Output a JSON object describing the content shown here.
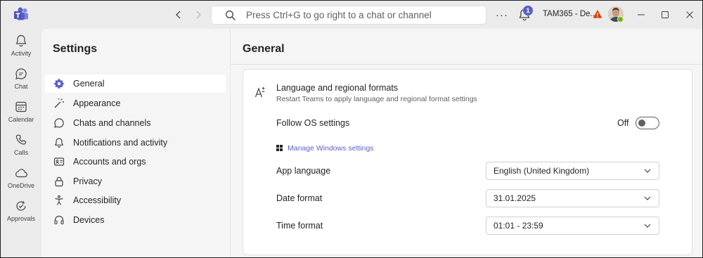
{
  "titlebar": {
    "search_placeholder": "Press Ctrl+G to go right to a chat or channel",
    "more_label": "···",
    "activity_badge": "1",
    "tenant_name": "TAM365 - De..."
  },
  "rail": [
    {
      "label": "Activity",
      "icon": "bell-icon"
    },
    {
      "label": "Chat",
      "icon": "chat-icon"
    },
    {
      "label": "Calendar",
      "icon": "calendar-icon"
    },
    {
      "label": "Calls",
      "icon": "phone-icon"
    },
    {
      "label": "OneDrive",
      "icon": "cloud-icon"
    },
    {
      "label": "Approvals",
      "icon": "approvals-icon"
    }
  ],
  "settings": {
    "title": "Settings",
    "items": [
      {
        "label": "General",
        "icon": "gear-icon",
        "selected": true
      },
      {
        "label": "Appearance",
        "icon": "wand-icon"
      },
      {
        "label": "Chats and channels",
        "icon": "chat-icon"
      },
      {
        "label": "Notifications and activity",
        "icon": "bell-icon"
      },
      {
        "label": "Accounts and orgs",
        "icon": "id-card-icon"
      },
      {
        "label": "Privacy",
        "icon": "lock-icon"
      },
      {
        "label": "Accessibility",
        "icon": "accessibility-icon"
      },
      {
        "label": "Devices",
        "icon": "headset-icon"
      }
    ]
  },
  "main": {
    "title": "General",
    "language_section": {
      "title": "Language and regional formats",
      "subtitle": "Restart Teams to apply language and regional format settings",
      "follow_os_label": "Follow OS settings",
      "follow_os_state": "Off",
      "manage_windows_link": "Manage Windows settings",
      "app_language_label": "App language",
      "app_language_value": "English (United Kingdom)",
      "date_format_label": "Date format",
      "date_format_value": "31.01.2025",
      "time_format_label": "Time format",
      "time_format_value": "01:01 - 23:59"
    }
  },
  "colors": {
    "accent": "#5b5fc7",
    "warning": "#d83b01",
    "presence": "#6bb700"
  }
}
